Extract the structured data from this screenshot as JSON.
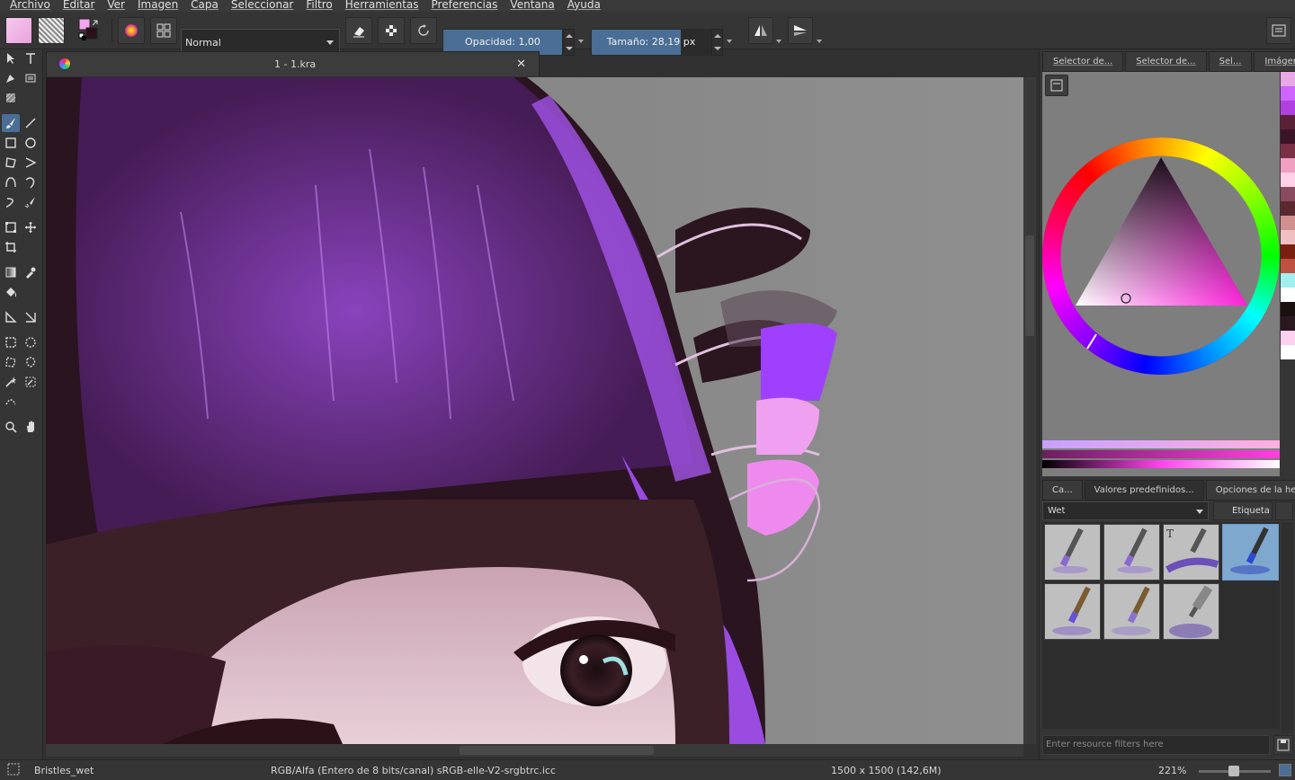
{
  "menu": [
    "Archivo",
    "Editar",
    "Ver",
    "Imagen",
    "Capa",
    "Seleccionar",
    "Filtro",
    "Herramientas",
    "Preferencias",
    "Ventana",
    "Ayuda"
  ],
  "toolbar": {
    "blend_mode": "Normal",
    "opacity_label": "Opacidad:  1,00",
    "opacity_value": 1.0,
    "size_label": "Tamaño:  28,19 px",
    "size_value": 28.19
  },
  "document": {
    "tab_title": "1 - 1.kra"
  },
  "right_tabs": [
    "Selector de...",
    "Selector de...",
    "Sel...",
    "Imágen..."
  ],
  "palette": [
    "#e6a8e6",
    "#cc66ff",
    "#b040e0",
    "#5a2035",
    "#3a1525",
    "#7a3045",
    "#f0a0c0",
    "#ffd0e8",
    "#8a4a60",
    "#5a2830",
    "#d09090",
    "#f0c0c0",
    "#7a2010",
    "#c05040",
    "#a0f0f0",
    "#ffffff",
    "#1a1010",
    "#2a1820",
    "#ffd0f0",
    "#ffffff"
  ],
  "bottom_tabs": [
    "Ca...",
    "Valores predefinidos...",
    "Opciones de la he..."
  ],
  "presets": {
    "filter_tag": "Wet",
    "tag_button": "Etiqueta",
    "filter_placeholder": "Enter resource filters here"
  },
  "status": {
    "preset_name": "Bristles_wet",
    "color_space": "RGB/Alfa (Entero de 8 bits/canal)  sRGB-elle-V2-srgbtrc.icc",
    "dimensions": "1500 x 1500 (142,6M)",
    "zoom": "221%"
  }
}
